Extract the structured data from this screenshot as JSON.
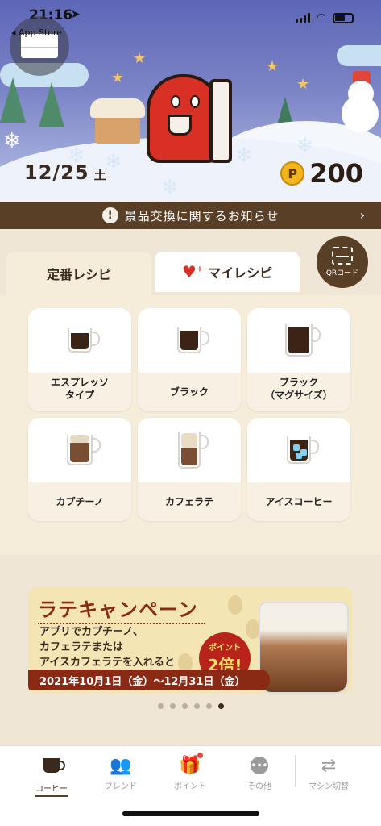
{
  "status_bar": {
    "time": "21:16",
    "back_app": "◂ App Store"
  },
  "hero": {
    "date_main": "12/25",
    "date_weekday": "土",
    "points_symbol": "P",
    "points_value": "200"
  },
  "notice": {
    "text": "景品交換に関するお知らせ",
    "arrow": "›"
  },
  "tabs": {
    "standard": "定番レシピ",
    "my": "マイレシピ"
  },
  "qr": {
    "label": "QRコード"
  },
  "recipes": [
    {
      "label": "エスプレッソ\nタイプ",
      "cup": "espresso"
    },
    {
      "label": "ブラック",
      "cup": "black"
    },
    {
      "label": "ブラック\n（マグサイズ）",
      "cup": "mug"
    },
    {
      "label": "カプチーノ",
      "cup": "cappuccino"
    },
    {
      "label": "カフェラテ",
      "cup": "latte"
    },
    {
      "label": "アイスコーヒー",
      "cup": "iced"
    }
  ],
  "banner": {
    "title": "ラテキャンペーン",
    "body": "アプリでカプチーノ、\nカフェラテまたは\nアイスカフェラテを入れると",
    "badge_small": "ポイント",
    "badge_large": "2倍!",
    "period": "2021年10月1日（金）〜12月31日（金）"
  },
  "carousel": {
    "count": 6,
    "active_index": 5
  },
  "nav": [
    {
      "label": "コーヒー",
      "icon": "coffee-cup-icon",
      "active": true
    },
    {
      "label": "フレンド",
      "icon": "friends-icon",
      "active": false
    },
    {
      "label": "ポイント",
      "icon": "gift-icon",
      "active": false,
      "badge": true
    },
    {
      "label": "その他",
      "icon": "more-icon",
      "active": false
    },
    {
      "label": "マシン切替",
      "icon": "switch-icon",
      "active": false
    }
  ],
  "colors": {
    "brown": "#5a3f27",
    "accent_red": "#d93025",
    "cream": "#f6ecda"
  }
}
